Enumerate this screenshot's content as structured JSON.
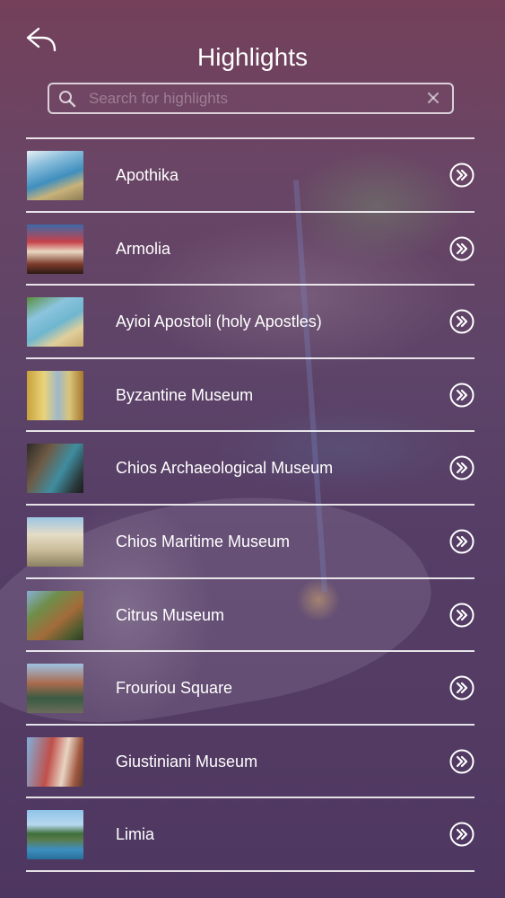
{
  "header": {
    "title": "Highlights",
    "back_icon": "back-arrow-icon"
  },
  "search": {
    "placeholder": "Search for highlights",
    "value": "",
    "icon": "search-icon",
    "clear_icon": "clear-icon"
  },
  "list": {
    "items": [
      {
        "label": "Apothika"
      },
      {
        "label": "Armolia"
      },
      {
        "label": "Ayioi Apostoli (holy Apostles)"
      },
      {
        "label": "Byzantine Museum"
      },
      {
        "label": "Chios Archaeological Museum"
      },
      {
        "label": "Chios Maritime Museum"
      },
      {
        "label": "Citrus Museum"
      },
      {
        "label": "Frouriou Square"
      },
      {
        "label": "Giustiniani Museum"
      },
      {
        "label": "Limia"
      }
    ],
    "row_action_icon": "double-chevron-right-circle-icon"
  },
  "colors": {
    "text": "#ffffff",
    "divider": "#ffffff",
    "background_tint": "#5e4468"
  }
}
